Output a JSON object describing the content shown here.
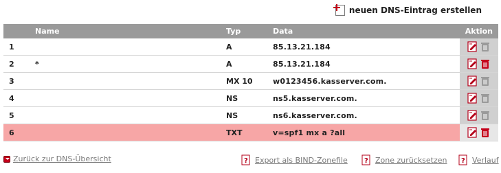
{
  "header": {
    "new_entry_label": "neuen DNS-Eintrag erstellen"
  },
  "table": {
    "columns": {
      "id": "",
      "name": "Name",
      "type": "Typ",
      "data": "Data",
      "action": "Aktion"
    },
    "rows": [
      {
        "id": "1",
        "name": "",
        "type": "A",
        "data": "85.13.21.184",
        "delete_enabled": false
      },
      {
        "id": "2",
        "name": "*",
        "type": "A",
        "data": "85.13.21.184",
        "delete_enabled": true
      },
      {
        "id": "3",
        "name": "",
        "type": "MX 10",
        "data": "w0123456.kasserver.com.",
        "delete_enabled": false
      },
      {
        "id": "4",
        "name": "",
        "type": "NS",
        "data": "ns5.kasserver.com.",
        "delete_enabled": false
      },
      {
        "id": "5",
        "name": "",
        "type": "NS",
        "data": "ns6.kasserver.com.",
        "delete_enabled": false
      },
      {
        "id": "6",
        "name": "",
        "type": "TXT",
        "data": "v=spf1 mx a ?all",
        "delete_enabled": true,
        "highlighted": true
      }
    ]
  },
  "footer": {
    "back_label": "Zurück zur DNS-Übersicht",
    "export_label": "Export als BIND-Zonefile",
    "reset_label": "Zone zurücksetzen",
    "history_label": "Verlauf"
  },
  "colors": {
    "accent": "#c4001a",
    "header_bg": "#9a9a9a",
    "highlight_row": "#f7a6a6"
  }
}
